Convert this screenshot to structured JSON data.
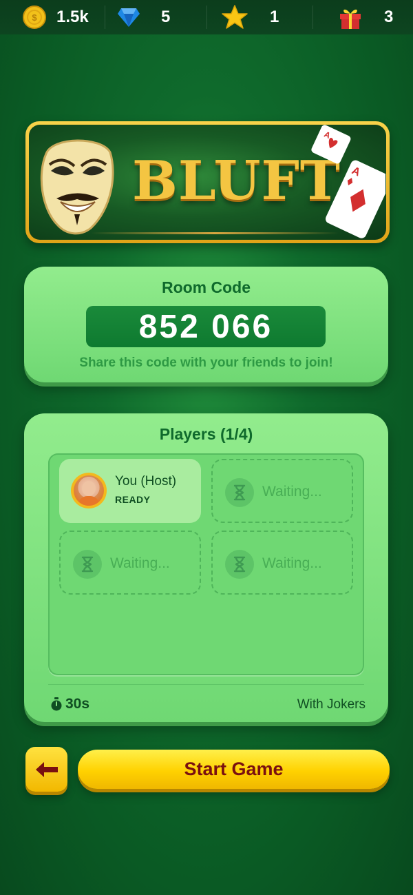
{
  "topbar": {
    "coins": {
      "icon": "coin-icon",
      "value": "1.5k"
    },
    "gems": {
      "icon": "gem-icon",
      "value": "5"
    },
    "stars": {
      "icon": "star-icon",
      "value": "1"
    },
    "gifts": {
      "icon": "gift-icon",
      "value": "3"
    }
  },
  "banner": {
    "title": "BLUFT",
    "mask_icon": "mask-icon",
    "cards_icon": "playing-cards-icon"
  },
  "room": {
    "heading": "Room Code",
    "code": "852 066",
    "share_text": "Share this code with your friends to join!"
  },
  "players": {
    "heading": "Players (1/4)",
    "slots": [
      {
        "name": "You (Host)",
        "status": "READY",
        "filled": true
      },
      {
        "name": "Waiting...",
        "filled": false
      },
      {
        "name": "Waiting...",
        "filled": false
      },
      {
        "name": "Waiting...",
        "filled": false
      }
    ],
    "timer": "30s",
    "mode": "With Jokers"
  },
  "buttons": {
    "back_icon": "back-arrow-icon",
    "start_label": "Start Game"
  },
  "colors": {
    "background": "#0a5a24",
    "card": "#86e482",
    "heading_green": "#0f6a2c",
    "start_button": "#ffd100",
    "start_text": "#7a1010",
    "gold": "#f4c542"
  }
}
